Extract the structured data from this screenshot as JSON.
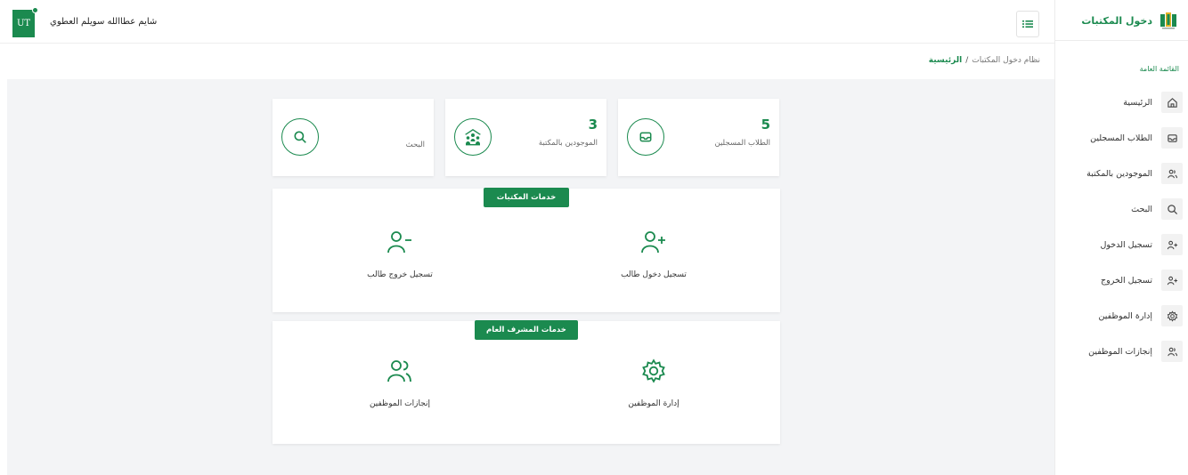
{
  "brand": {
    "name": "دخول المكتبات"
  },
  "sidebar": {
    "section_title": "القائمة العامة",
    "items": [
      {
        "label": "الرئيسية",
        "icon": "home-icon"
      },
      {
        "label": "الطلاب المسجلين",
        "icon": "inbox-icon"
      },
      {
        "label": "الموجودين بالمكتبة",
        "icon": "users-icon"
      },
      {
        "label": "البحث",
        "icon": "search-icon"
      },
      {
        "label": "تسجيل الدخول",
        "icon": "user-plus-icon"
      },
      {
        "label": "تسجيل الخروج",
        "icon": "user-plus-icon"
      },
      {
        "label": "إدارة الموظفين",
        "icon": "gear-icon"
      },
      {
        "label": "إنجازات الموظفين",
        "icon": "users-icon"
      }
    ]
  },
  "header": {
    "user_initials": "UT",
    "user_name": "شايم عطاالله سويلم العطوي",
    "menu_icon": "list-icon"
  },
  "breadcrumb": {
    "root": "نظام دخول المكتبات",
    "separator": "/",
    "current": "الرئيسية"
  },
  "stats": {
    "registered": {
      "value": "5",
      "label": "الطلاب المسجلين",
      "icon": "inbox-icon"
    },
    "present": {
      "value": "3",
      "label": "الموجودين بالمكتبة",
      "icon": "reading-people-icon"
    },
    "search": {
      "label": "البحث",
      "icon": "search-icon"
    }
  },
  "library_services": {
    "title": "خدمات المكتبات",
    "check_in": {
      "label": "تسجيل دخول طالب",
      "icon": "user-plus-icon"
    },
    "check_out": {
      "label": "تسجيل خروج طالب",
      "icon": "user-minus-icon"
    }
  },
  "supervisor_services": {
    "title": "خدمات المشرف العام",
    "manage_staff": {
      "label": "إدارة الموظفين",
      "icon": "gear-icon"
    },
    "staff_achievements": {
      "label": "إنجازات الموظفين",
      "icon": "users-icon"
    }
  },
  "colors": {
    "accent": "#1b8a4f",
    "background": "#f3f4f6"
  }
}
